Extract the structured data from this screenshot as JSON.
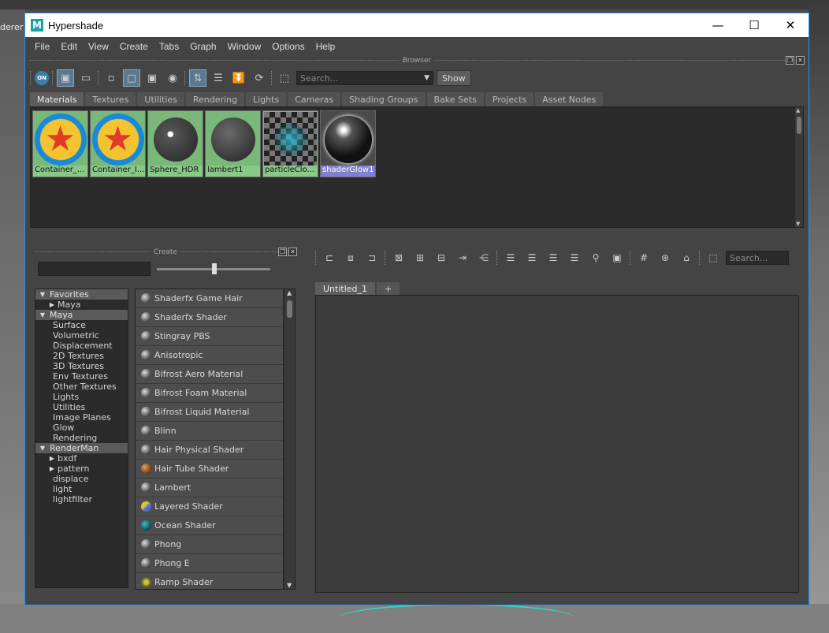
{
  "background": {
    "left_text": "derer"
  },
  "window": {
    "title": "Hypershade",
    "icon_letter": "M",
    "controls": {
      "minimize": "—",
      "maximize": "☐",
      "close": "✕"
    }
  },
  "menu": [
    "File",
    "Edit",
    "View",
    "Create",
    "Tabs",
    "Graph",
    "Window",
    "Options",
    "Help"
  ],
  "browser": {
    "section_label": "Browser",
    "on_label": "ON",
    "search_placeholder": "Search...",
    "show_button": "Show",
    "tabs": [
      "Materials",
      "Textures",
      "Utilities",
      "Rendering",
      "Lights",
      "Cameras",
      "Shading Groups",
      "Bake Sets",
      "Projects",
      "Asset Nodes"
    ],
    "swatches": [
      "Container_...",
      "Container_I...",
      "Sphere_HDR",
      "lambert1",
      "particleClo...",
      "shaderGlow1"
    ]
  },
  "create": {
    "section_label": "Create",
    "tree": [
      {
        "label": "Favorites",
        "kind": "header",
        "open": true
      },
      {
        "label": "Maya",
        "kind": "child-collapsed"
      },
      {
        "label": "Maya",
        "kind": "header",
        "open": true
      },
      {
        "label": "Surface",
        "kind": "leaf"
      },
      {
        "label": "Volumetric",
        "kind": "leaf"
      },
      {
        "label": "Displacement",
        "kind": "leaf"
      },
      {
        "label": "2D Textures",
        "kind": "leaf"
      },
      {
        "label": "3D Textures",
        "kind": "leaf"
      },
      {
        "label": "Env Textures",
        "kind": "leaf"
      },
      {
        "label": "Other Textures",
        "kind": "leaf"
      },
      {
        "label": "Lights",
        "kind": "leaf"
      },
      {
        "label": "Utilities",
        "kind": "leaf"
      },
      {
        "label": "Image Planes",
        "kind": "leaf"
      },
      {
        "label": "Glow",
        "kind": "leaf"
      },
      {
        "label": "Rendering",
        "kind": "leaf"
      },
      {
        "label": "RenderMan",
        "kind": "header",
        "open": true
      },
      {
        "label": "bxdf",
        "kind": "child-collapsed"
      },
      {
        "label": "pattern",
        "kind": "child-collapsed"
      },
      {
        "label": "displace",
        "kind": "leaf"
      },
      {
        "label": "light",
        "kind": "leaf"
      },
      {
        "label": "lightfilter",
        "kind": "leaf"
      }
    ],
    "nodes": [
      "Shaderfx Game Hair",
      "Shaderfx Shader",
      "Stingray PBS",
      "Anisotropic",
      "Bifrost Aero Material",
      "Bifrost Foam Material",
      "Bifrost Liquid Material",
      "Blinn",
      "Hair Physical Shader",
      "Hair Tube Shader",
      "Lambert",
      "Layered Shader",
      "Ocean Shader",
      "Phong",
      "Phong E",
      "Ramp Shader"
    ]
  },
  "graph": {
    "search_placeholder": "Search...",
    "tabs": [
      "Untitled_1",
      "+"
    ]
  },
  "colors": {
    "accent": "#1e90ff",
    "swatch_label": "#88c888",
    "swatch_selected": "#8080d0",
    "header_bg": "#5a5a5a"
  }
}
